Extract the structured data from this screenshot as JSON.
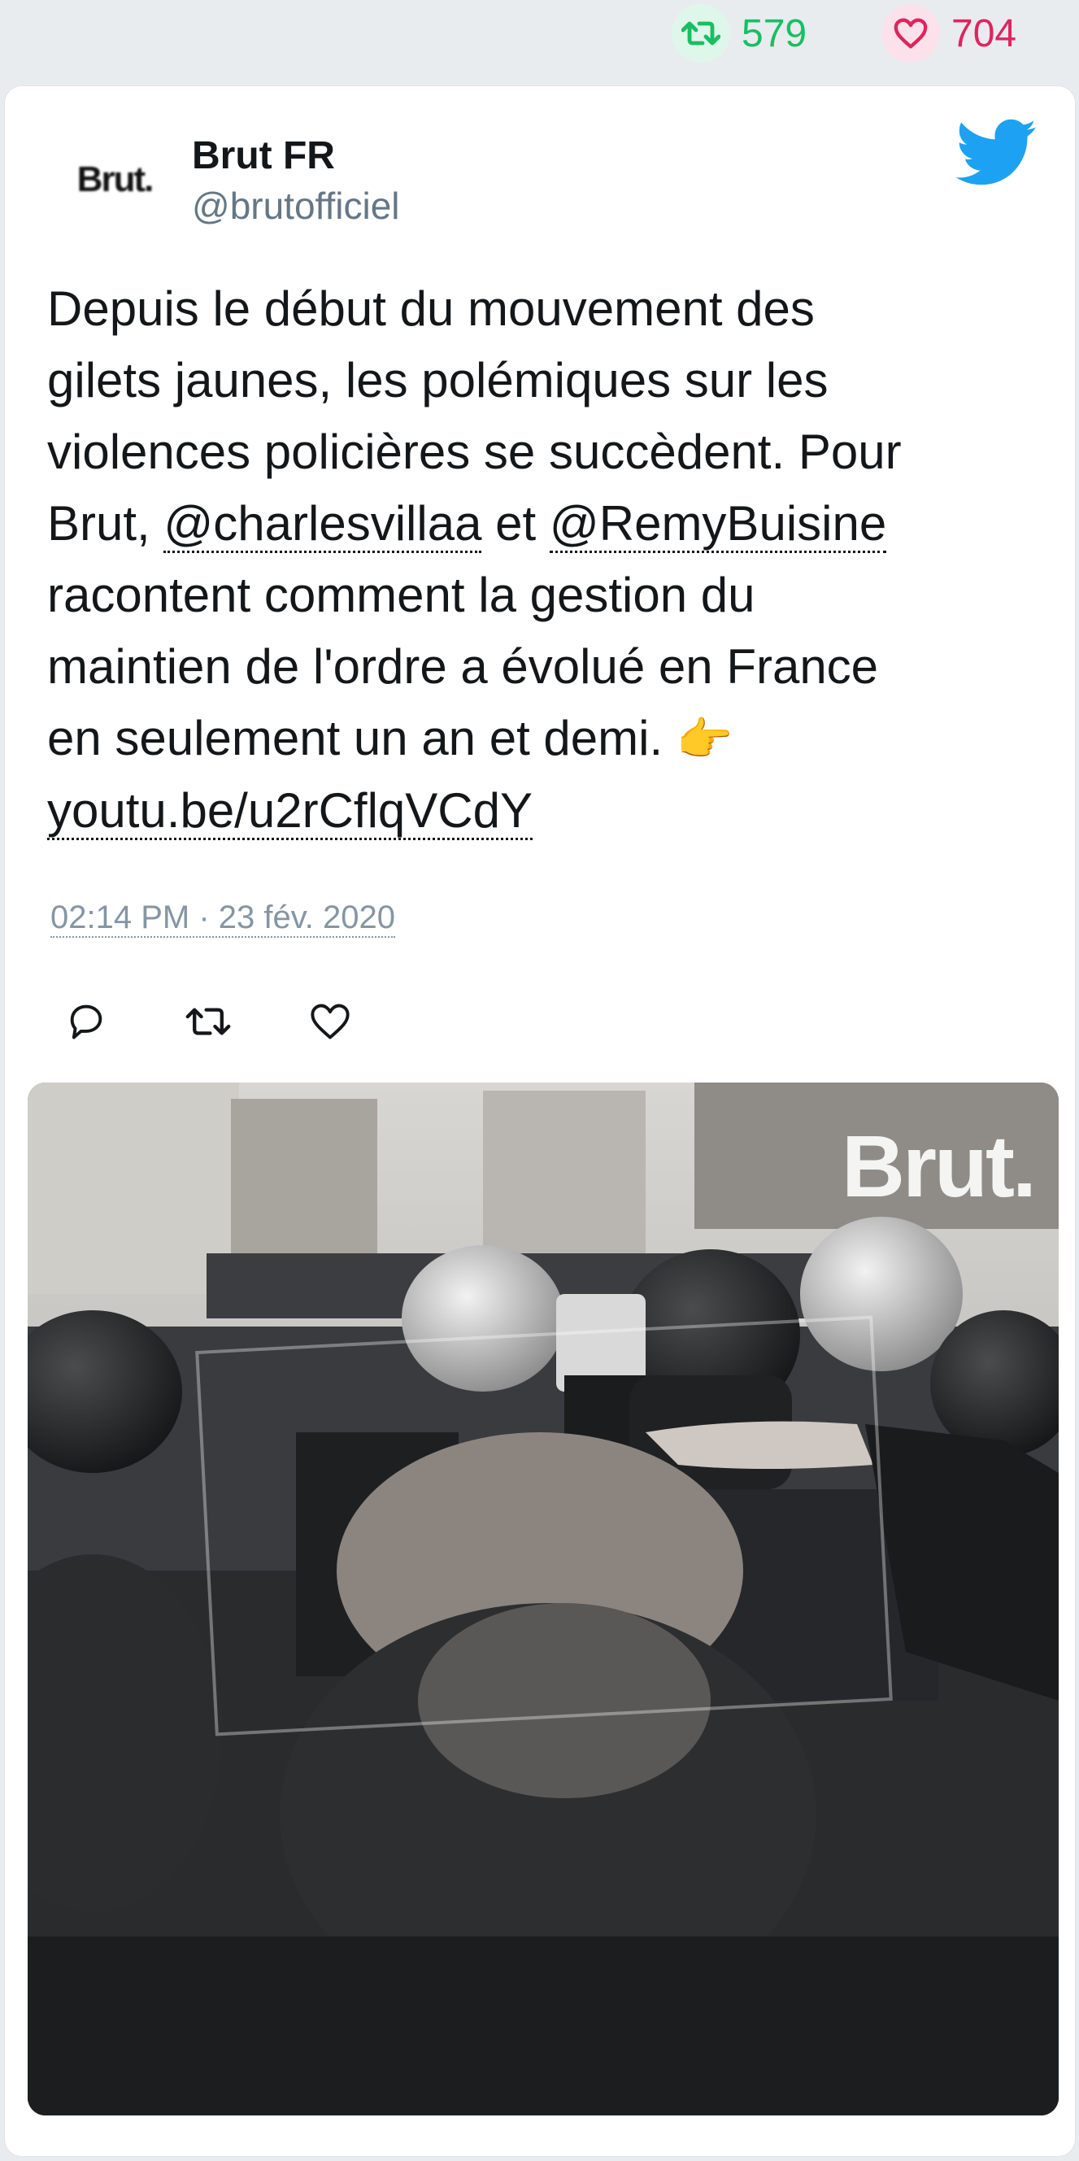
{
  "stats": {
    "retweets": "579",
    "likes": "704"
  },
  "author": {
    "avatar_text": "Brut.",
    "name": "Brut FR",
    "handle": "@brutofficiel"
  },
  "tweet": {
    "line1": "Depuis le début du mouvement des",
    "line2": "gilets jaunes, les polémiques sur les",
    "line3": "violences policières se succèdent. Pour",
    "line4_pre": "Brut, ",
    "mention1": "@charlesvillaa",
    "line4_mid": " et ",
    "mention2": "@RemyBuisine",
    "line5": "racontent comment la gestion du",
    "line6": "maintien de l'ordre a évolué en France",
    "line7": "en seulement un an et demi. ",
    "emoji": "👉",
    "link": "youtu.be/u2rCflqVCdY"
  },
  "timestamp": "02:14 PM · 23 fév. 2020",
  "media": {
    "watermark": "Brut."
  },
  "colors": {
    "retweet": "#17bf63",
    "like": "#e0245e",
    "twitter_blue": "#1da1f2"
  }
}
